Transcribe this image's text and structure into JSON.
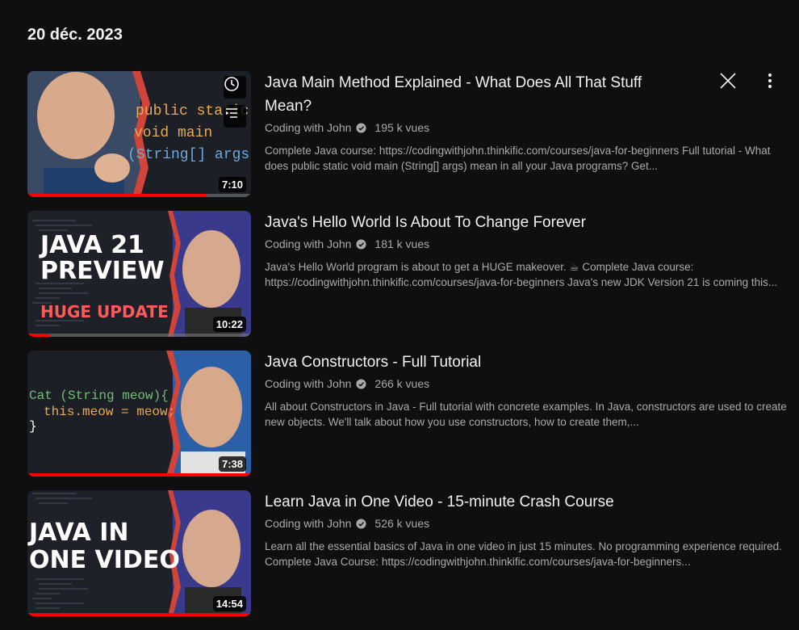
{
  "section": {
    "date": "20 déc. 2023"
  },
  "videos": [
    {
      "title": "Java Main Method Explained - What Does All That Stuff Mean?",
      "channel": "Coding with John",
      "views": "195 k vues",
      "description": "Complete Java course: https://codingwithjohn.thinkific.com/courses/java-for-beginners Full tutorial - What does public static void main (String[] args) mean in all your Java programs? Get...",
      "duration": "7:10",
      "progress": 0.8,
      "thumb_code": [
        "public static",
        "void main",
        "(String[] args){"
      ]
    },
    {
      "title": "Java's Hello World Is About To Change Forever",
      "channel": "Coding with John",
      "views": "181 k vues",
      "description": "Java's Hello World program is about to get a HUGE makeover. ☕ Complete Java course: https://codingwithjohn.thinkific.com/courses/java-for-beginners Java's new JDK Version 21 is coming this...",
      "duration": "10:22",
      "progress": 0.1,
      "thumb_text": [
        "JAVA 21",
        "PREVIEW",
        "HUGE UPDATE"
      ]
    },
    {
      "title": "Java Constructors - Full Tutorial",
      "channel": "Coding with John",
      "views": "266 k vues",
      "description": "All about Constructors in Java - Full tutorial with concrete examples. In Java, constructors are used to create new objects. We'll talk about how you use constructors, how to create them,...",
      "duration": "7:38",
      "progress": 1.0,
      "thumb_code": [
        "Cat (String meow){",
        "this.meow = meow;",
        "}"
      ]
    },
    {
      "title": "Learn Java in One Video - 15-minute Crash Course",
      "channel": "Coding with John",
      "views": "526 k vues",
      "description": "Learn all the essential basics of Java in one video in just 15 minutes. No programming experience required. Complete Java Course: https://codingwithjohn.thinkific.com/courses/java-for-beginners...",
      "duration": "14:54",
      "progress": 1.0,
      "thumb_text": [
        "JAVA IN",
        "ONE VIDEO"
      ]
    }
  ],
  "icons": {
    "watch_later": "clock-icon",
    "add_to_queue": "queue-icon",
    "remove": "close-icon",
    "more": "more-vert-icon",
    "verified": "verified-check-icon"
  },
  "colors": {
    "background": "#0f0f0f",
    "accent": "#ff0000",
    "secondary_text": "#aaaaaa"
  }
}
